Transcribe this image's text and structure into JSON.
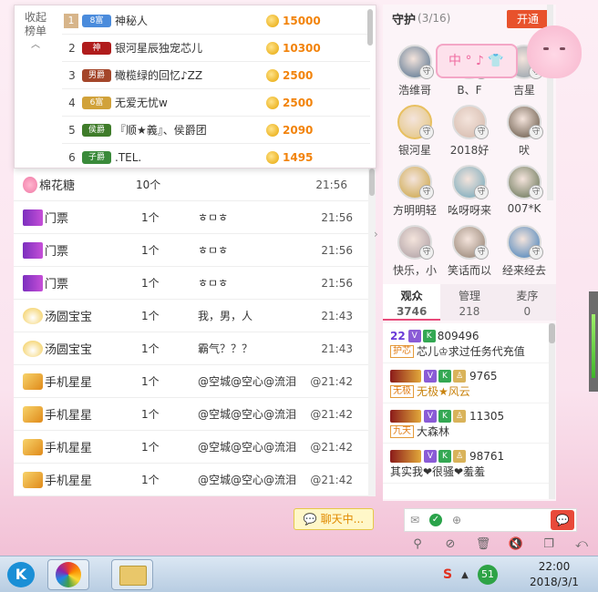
{
  "ranking": {
    "collapse_label": "收起\n榜单",
    "rows": [
      {
        "rank": "1",
        "badge": "8富",
        "badge_color": "#4a8bdc",
        "name": "神秘人",
        "score": "15000"
      },
      {
        "rank": "2",
        "badge": "神",
        "badge_color": "#b01c1c",
        "name": "银河星辰独宠芯儿",
        "score": "10300"
      },
      {
        "rank": "3",
        "badge": "男爵",
        "badge_color": "#a4462a",
        "name": "橄榄绿的回忆♪ZZ",
        "score": "2500"
      },
      {
        "rank": "4",
        "badge": "6富",
        "badge_color": "#d1a23a",
        "name": "无爱无忧w",
        "score": "2500"
      },
      {
        "rank": "5",
        "badge": "侯爵",
        "badge_color": "#3f7c2a",
        "name": "『顺★義』、侯爵团",
        "score": "2090"
      },
      {
        "rank": "6",
        "badge": "子爵",
        "badge_color": "#3a8a3a",
        "name": ".TEL.",
        "score": "1495"
      }
    ]
  },
  "gift_list": [
    {
      "name": "棉花糖",
      "count": "10个",
      "message": "",
      "time": "21:56",
      "icon": "candy-icon"
    },
    {
      "name": "门票",
      "count": "1个",
      "message": "ㅎㅁㅎ",
      "time": "21:56",
      "icon": "ticket-icon"
    },
    {
      "name": "门票",
      "count": "1个",
      "message": "ㅎㅁㅎ",
      "time": "21:56",
      "icon": "ticket-icon"
    },
    {
      "name": "门票",
      "count": "1个",
      "message": "ㅎㅁㅎ",
      "time": "21:56",
      "icon": "ticket-icon"
    },
    {
      "name": "汤圆宝宝",
      "count": "1个",
      "message": "我，男，人",
      "time": "21:43",
      "icon": "dumpling-icon"
    },
    {
      "name": "汤圆宝宝",
      "count": "1个",
      "message": "霸气？？？",
      "time": "21:43",
      "icon": "dumpling-icon"
    },
    {
      "name": "手机星星",
      "count": "1个",
      "message": "@空城@空心@流泪",
      "time": "@21:42",
      "icon": "star-phone-icon"
    },
    {
      "name": "手机星星",
      "count": "1个",
      "message": "@空城@空心@流泪",
      "time": "@21:42",
      "icon": "star-phone-icon"
    },
    {
      "name": "手机星星",
      "count": "1个",
      "message": "@空城@空心@流泪",
      "time": "@21:42",
      "icon": "star-phone-icon"
    },
    {
      "name": "手机星星",
      "count": "1个",
      "message": "@空城@空心@流泪",
      "time": "@21:42",
      "icon": "star-phone-icon"
    }
  ],
  "guard": {
    "title": "守护",
    "count": "(3/16)",
    "open_label": "开通",
    "members": [
      {
        "name": "浩维哥",
        "avatar_color": "#4b6b8a",
        "gold": false
      },
      {
        "name": "B、F",
        "avatar_color": "#c9a28a",
        "gold": false
      },
      {
        "name": "吉星",
        "avatar_color": "#8a9aa6",
        "gold": false
      },
      {
        "name": "银河星",
        "avatar_color": "#e2c37a",
        "gold": true
      },
      {
        "name": "2018好",
        "avatar_color": "#d2b6a8",
        "gold": false
      },
      {
        "name": "吠",
        "avatar_color": "#5a4b3a",
        "gold": false
      },
      {
        "name": "方明明轻",
        "avatar_color": "#c8a03a",
        "gold": false
      },
      {
        "name": "吆呀呀来",
        "avatar_color": "#6aa3b8",
        "gold": false
      },
      {
        "name": "007*K",
        "avatar_color": "#5a6a4a",
        "gold": false
      },
      {
        "name": "快乐，小",
        "avatar_color": "#a89aa0",
        "gold": false
      },
      {
        "name": "笑话而以",
        "avatar_color": "#8c7a6a",
        "gold": false
      },
      {
        "name": "经来经去",
        "avatar_color": "#3a7ab8",
        "gold": false
      }
    ]
  },
  "sticker_text": "中 ° ♪ 👕",
  "tabs": [
    {
      "label": "观众",
      "num": "3746",
      "active": true
    },
    {
      "label": "管理",
      "num": "218",
      "active": false
    },
    {
      "label": "麦序",
      "num": "0",
      "active": false
    }
  ],
  "audience": [
    {
      "level": "22",
      "uid": "809496",
      "badge": "护芯",
      "name": "芯儿♔求过任务代充值",
      "gold": false
    },
    {
      "level": "",
      "uid": "9765",
      "badge": "无极",
      "name": "无极★风云",
      "gold": true
    },
    {
      "level": "",
      "uid": "11305",
      "badge": "九天",
      "name": "大森林",
      "gold": false
    },
    {
      "level": "",
      "uid": "98761",
      "badge": "",
      "name": "其实我❤很骚❤羞羞",
      "gold": false
    }
  ],
  "chat_pill": "聊天中...",
  "taskbar": {
    "time": "22:00",
    "date": "2018/3/1",
    "tray_badge": "51",
    "tray_s": "S"
  }
}
